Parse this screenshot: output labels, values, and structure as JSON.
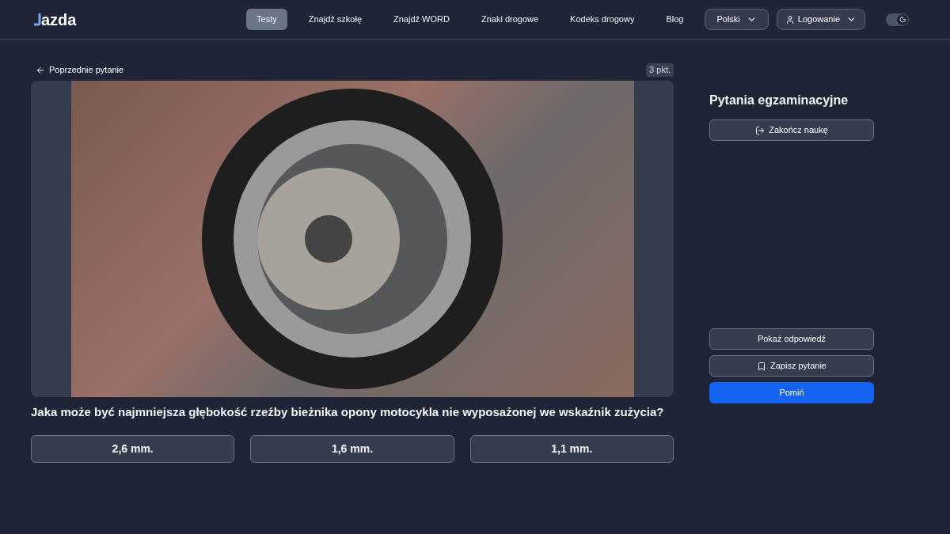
{
  "header": {
    "logo": "azda",
    "nav": [
      {
        "label": "Testy",
        "selected": true
      },
      {
        "label": "Znajdź szkołę",
        "selected": false
      },
      {
        "label": "Znajdź WORD",
        "selected": false
      },
      {
        "label": "Znaki drogowe",
        "selected": false
      },
      {
        "label": "Kodeks drogowy",
        "selected": false
      },
      {
        "label": "Blog",
        "selected": false
      }
    ],
    "language": "Polski",
    "login": "Logowanie",
    "dark_mode": true
  },
  "question": {
    "back_link": "Poprzednie pytanie",
    "points": "3 pkt.",
    "text": "Jaka może być najmniejsza głębokość rzeźby bieżnika opony motocykla nie wyposażonej we wskaźnik zużycia?",
    "answers": [
      "2,6 mm.",
      "1,6 mm.",
      "1,1 mm."
    ]
  },
  "sidebar": {
    "title": "Pytania egzaminacyjne",
    "end_button": "Zakończ naukę",
    "show_answer": "Pokaż odpowiedź",
    "save_button": "Zapisz pytanie",
    "skip_button": "Pomiń"
  }
}
